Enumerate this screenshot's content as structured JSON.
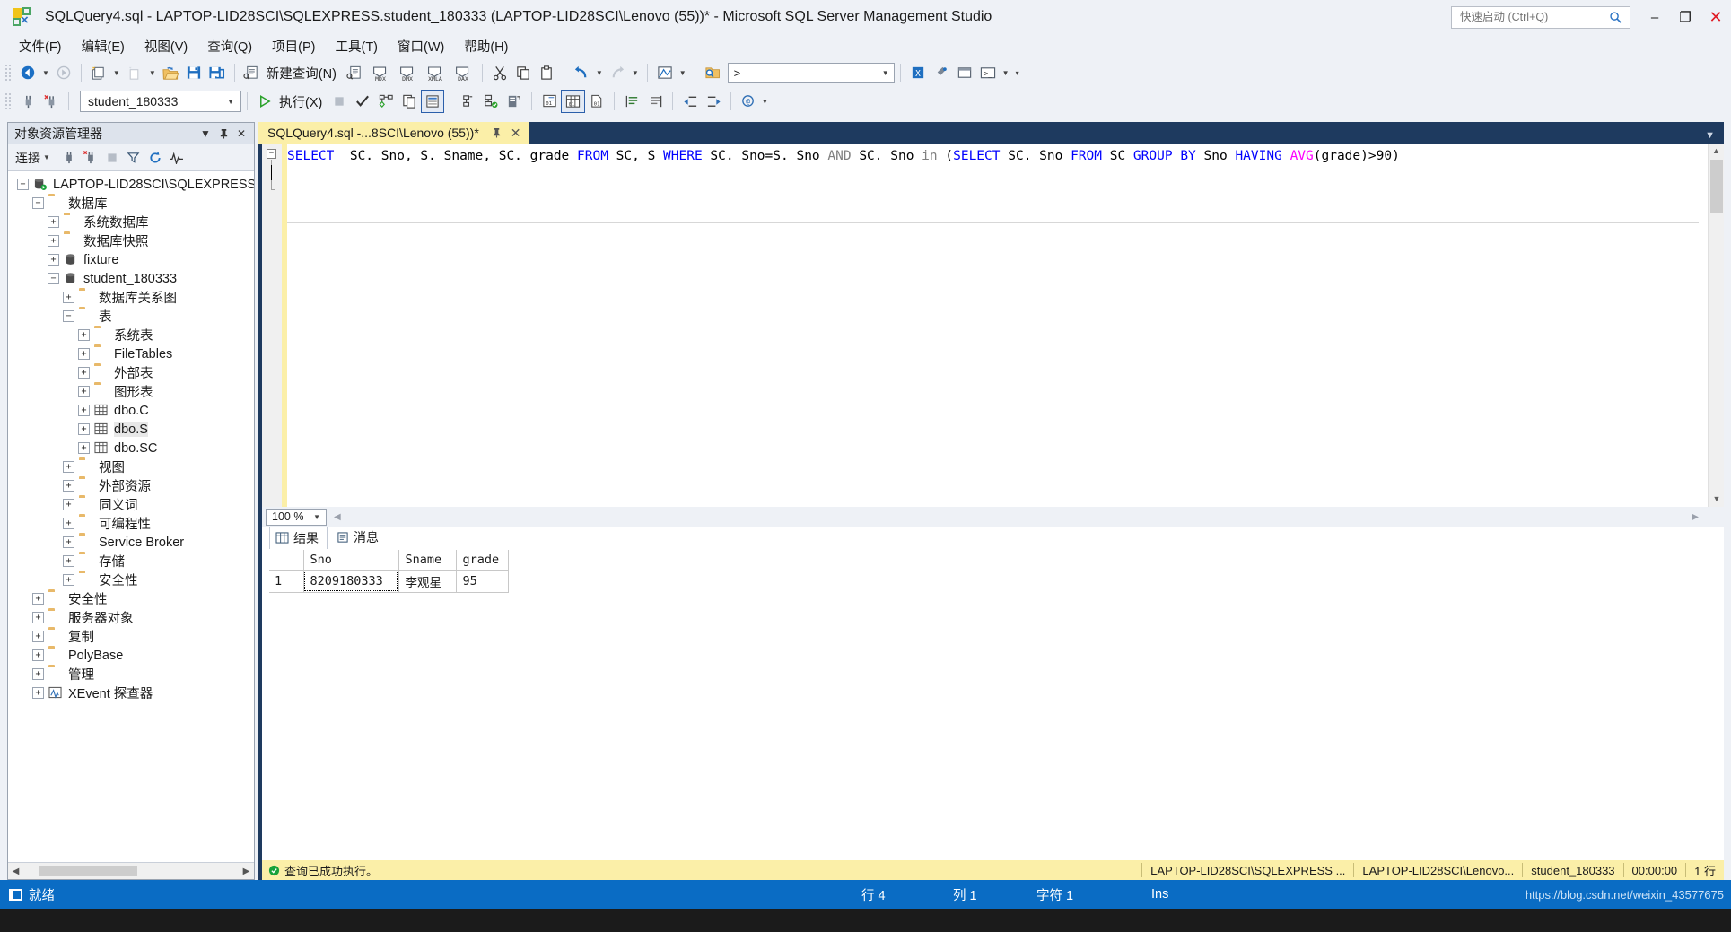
{
  "window": {
    "title": "SQLQuery4.sql - LAPTOP-LID28SCI\\SQLEXPRESS.student_180333 (LAPTOP-LID28SCI\\Lenovo (55))* - Microsoft SQL Server Management Studio",
    "app_icon": "ssms-icon",
    "minimize_label": "–",
    "maximize_label": "❐",
    "close_label": "✕"
  },
  "quick_launch": {
    "placeholder": "快速启动 (Ctrl+Q)",
    "value": "",
    "icon": "search-icon"
  },
  "menubar": {
    "items": [
      {
        "label": "文件(F)",
        "name": "menu-file"
      },
      {
        "label": "编辑(E)",
        "name": "menu-edit"
      },
      {
        "label": "视图(V)",
        "name": "menu-view"
      },
      {
        "label": "查询(Q)",
        "name": "menu-query"
      },
      {
        "label": "项目(P)",
        "name": "menu-project"
      },
      {
        "label": "工具(T)",
        "name": "menu-tools"
      },
      {
        "label": "窗口(W)",
        "name": "menu-window"
      },
      {
        "label": "帮助(H)",
        "name": "menu-help"
      }
    ]
  },
  "toolbar1": {
    "new_query_label": "新建查询(N)",
    "mdx_label": "MDX",
    "dmx_label": "DMX",
    "xmla_label": "XMLA",
    "dax_label": "DAX",
    "find_value": ">",
    "find_placeholder": ""
  },
  "toolbar2": {
    "database_value": "student_180333",
    "execute_label": "执行(X)"
  },
  "object_explorer": {
    "title": "对象资源管理器",
    "connect_label": "连接",
    "pin_icon": "pin-icon",
    "close_icon": "close-icon",
    "dropdown_icon": "chevron-down-icon",
    "tree": [
      {
        "label": "LAPTOP-LID28SCI\\SQLEXPRESS",
        "depth": 0,
        "state": "expanded",
        "icon": "server-icon"
      },
      {
        "label": "数据库",
        "depth": 1,
        "state": "expanded",
        "icon": "folder-icon"
      },
      {
        "label": "系统数据库",
        "depth": 2,
        "state": "collapsed",
        "icon": "folder-icon"
      },
      {
        "label": "数据库快照",
        "depth": 2,
        "state": "collapsed",
        "icon": "folder-icon"
      },
      {
        "label": "fixture",
        "depth": 2,
        "state": "collapsed",
        "icon": "database-icon"
      },
      {
        "label": "student_180333",
        "depth": 2,
        "state": "expanded",
        "icon": "database-icon"
      },
      {
        "label": "数据库关系图",
        "depth": 3,
        "state": "collapsed",
        "icon": "folder-icon"
      },
      {
        "label": "表",
        "depth": 3,
        "state": "expanded",
        "icon": "folder-icon"
      },
      {
        "label": "系统表",
        "depth": 4,
        "state": "collapsed",
        "icon": "folder-icon"
      },
      {
        "label": "FileTables",
        "depth": 4,
        "state": "collapsed",
        "icon": "folder-icon"
      },
      {
        "label": "外部表",
        "depth": 4,
        "state": "collapsed",
        "icon": "folder-icon"
      },
      {
        "label": "图形表",
        "depth": 4,
        "state": "collapsed",
        "icon": "folder-icon"
      },
      {
        "label": "dbo.C",
        "depth": 4,
        "state": "collapsed",
        "icon": "table-icon"
      },
      {
        "label": "dbo.S",
        "depth": 4,
        "state": "collapsed",
        "icon": "table-icon",
        "selected": true
      },
      {
        "label": "dbo.SC",
        "depth": 4,
        "state": "collapsed",
        "icon": "table-icon"
      },
      {
        "label": "视图",
        "depth": 3,
        "state": "collapsed",
        "icon": "folder-icon"
      },
      {
        "label": "外部资源",
        "depth": 3,
        "state": "collapsed",
        "icon": "folder-icon"
      },
      {
        "label": "同义词",
        "depth": 3,
        "state": "collapsed",
        "icon": "folder-icon"
      },
      {
        "label": "可编程性",
        "depth": 3,
        "state": "collapsed",
        "icon": "folder-icon"
      },
      {
        "label": "Service Broker",
        "depth": 3,
        "state": "collapsed",
        "icon": "folder-icon"
      },
      {
        "label": "存储",
        "depth": 3,
        "state": "collapsed",
        "icon": "folder-icon"
      },
      {
        "label": "安全性",
        "depth": 3,
        "state": "collapsed",
        "icon": "folder-icon"
      },
      {
        "label": "安全性",
        "depth": 1,
        "state": "collapsed",
        "icon": "folder-icon"
      },
      {
        "label": "服务器对象",
        "depth": 1,
        "state": "collapsed",
        "icon": "folder-icon"
      },
      {
        "label": "复制",
        "depth": 1,
        "state": "collapsed",
        "icon": "folder-icon"
      },
      {
        "label": "PolyBase",
        "depth": 1,
        "state": "collapsed",
        "icon": "folder-icon"
      },
      {
        "label": "管理",
        "depth": 1,
        "state": "collapsed",
        "icon": "folder-icon"
      },
      {
        "label": "XEvent 探查器",
        "depth": 1,
        "state": "collapsed",
        "icon": "xevent-icon"
      }
    ]
  },
  "editor": {
    "tab_label": "SQLQuery4.sql -...8SCI\\Lenovo (55))*",
    "tab_pin_icon": "pin-icon",
    "tab_close_icon": "close-icon",
    "zoom_value": "100 %",
    "sql_tokens": [
      {
        "t": "SELECT",
        "c": "k"
      },
      {
        "t": "  SC. Sno, S. Sname, SC. grade ",
        "c": ""
      },
      {
        "t": "FROM",
        "c": "k"
      },
      {
        "t": " SC, S ",
        "c": ""
      },
      {
        "t": "WHERE",
        "c": "k"
      },
      {
        "t": " SC. Sno=S. Sno ",
        "c": ""
      },
      {
        "t": "AND",
        "c": "kg"
      },
      {
        "t": " SC. Sno ",
        "c": ""
      },
      {
        "t": "in",
        "c": "kg"
      },
      {
        "t": " (",
        "c": ""
      },
      {
        "t": "SELECT",
        "c": "k"
      },
      {
        "t": " SC. Sno ",
        "c": ""
      },
      {
        "t": "FROM",
        "c": "k"
      },
      {
        "t": " SC ",
        "c": ""
      },
      {
        "t": "GROUP",
        "c": "k"
      },
      {
        "t": " ",
        "c": ""
      },
      {
        "t": "BY",
        "c": "k"
      },
      {
        "t": " Sno ",
        "c": ""
      },
      {
        "t": "HAVING",
        "c": "k"
      },
      {
        "t": " ",
        "c": ""
      },
      {
        "t": "AVG",
        "c": "kp"
      },
      {
        "t": "(grade)>90)",
        "c": ""
      }
    ],
    "collapse_glyph": "−"
  },
  "results": {
    "tabs": [
      {
        "label": "结果",
        "name": "tab-results",
        "icon": "grid-icon",
        "active": true
      },
      {
        "label": "消息",
        "name": "tab-messages",
        "icon": "message-icon",
        "active": false
      }
    ],
    "columns": [
      "Sno",
      "Sname",
      "grade"
    ],
    "rows": [
      {
        "num": "1",
        "Sno": "8209180333",
        "Sname": "李观星",
        "grade": "95"
      }
    ]
  },
  "query_status": {
    "icon": "success-icon",
    "message": "查询已成功执行。",
    "server": "LAPTOP-LID28SCI\\SQLEXPRESS ...",
    "user": "LAPTOP-LID28SCI\\Lenovo...",
    "database": "student_180333",
    "elapsed": "00:00:00",
    "rowcount": "1 行"
  },
  "statusbar": {
    "ready": "就绪",
    "line": "行 4",
    "column": "列 1",
    "character": "字符 1",
    "insert_mode": "Ins",
    "watermark": "https://blog.csdn.net/weixin_43577675"
  },
  "colors": {
    "accent": "#0a6cc4",
    "tab_active": "#fbefa8",
    "editor_frame": "#1e3a5f",
    "keyword": "#0000ff",
    "function": "#ff00ff",
    "operator": "#808080"
  }
}
